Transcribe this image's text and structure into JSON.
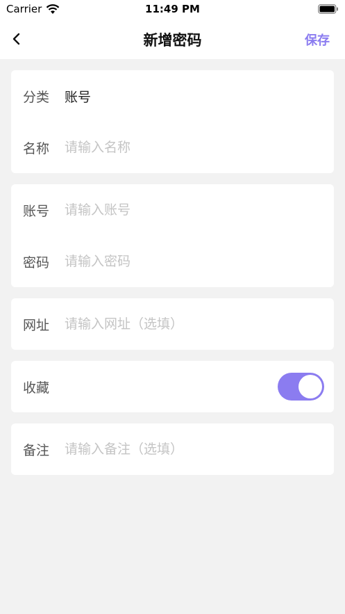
{
  "status_bar": {
    "carrier": "Carrier",
    "time": "11:49 PM"
  },
  "nav": {
    "title": "新增密码",
    "save_label": "保存",
    "back_icon": "chevron-left-icon"
  },
  "form": {
    "category": {
      "label": "分类",
      "value": "账号"
    },
    "name": {
      "label": "名称",
      "placeholder": "请输入名称",
      "value": ""
    },
    "account": {
      "label": "账号",
      "placeholder": "请输入账号",
      "value": ""
    },
    "password": {
      "label": "密码",
      "placeholder": "请输入密码",
      "value": ""
    },
    "url": {
      "label": "网址",
      "placeholder": "请输入网址（选填）",
      "value": ""
    },
    "favorite": {
      "label": "收藏",
      "enabled": true
    },
    "note": {
      "label": "备注",
      "placeholder": "请输入备注（选填）",
      "value": ""
    }
  },
  "colors": {
    "accent": "#8b7cf0",
    "background": "#f2f2f2",
    "card": "#ffffff"
  }
}
